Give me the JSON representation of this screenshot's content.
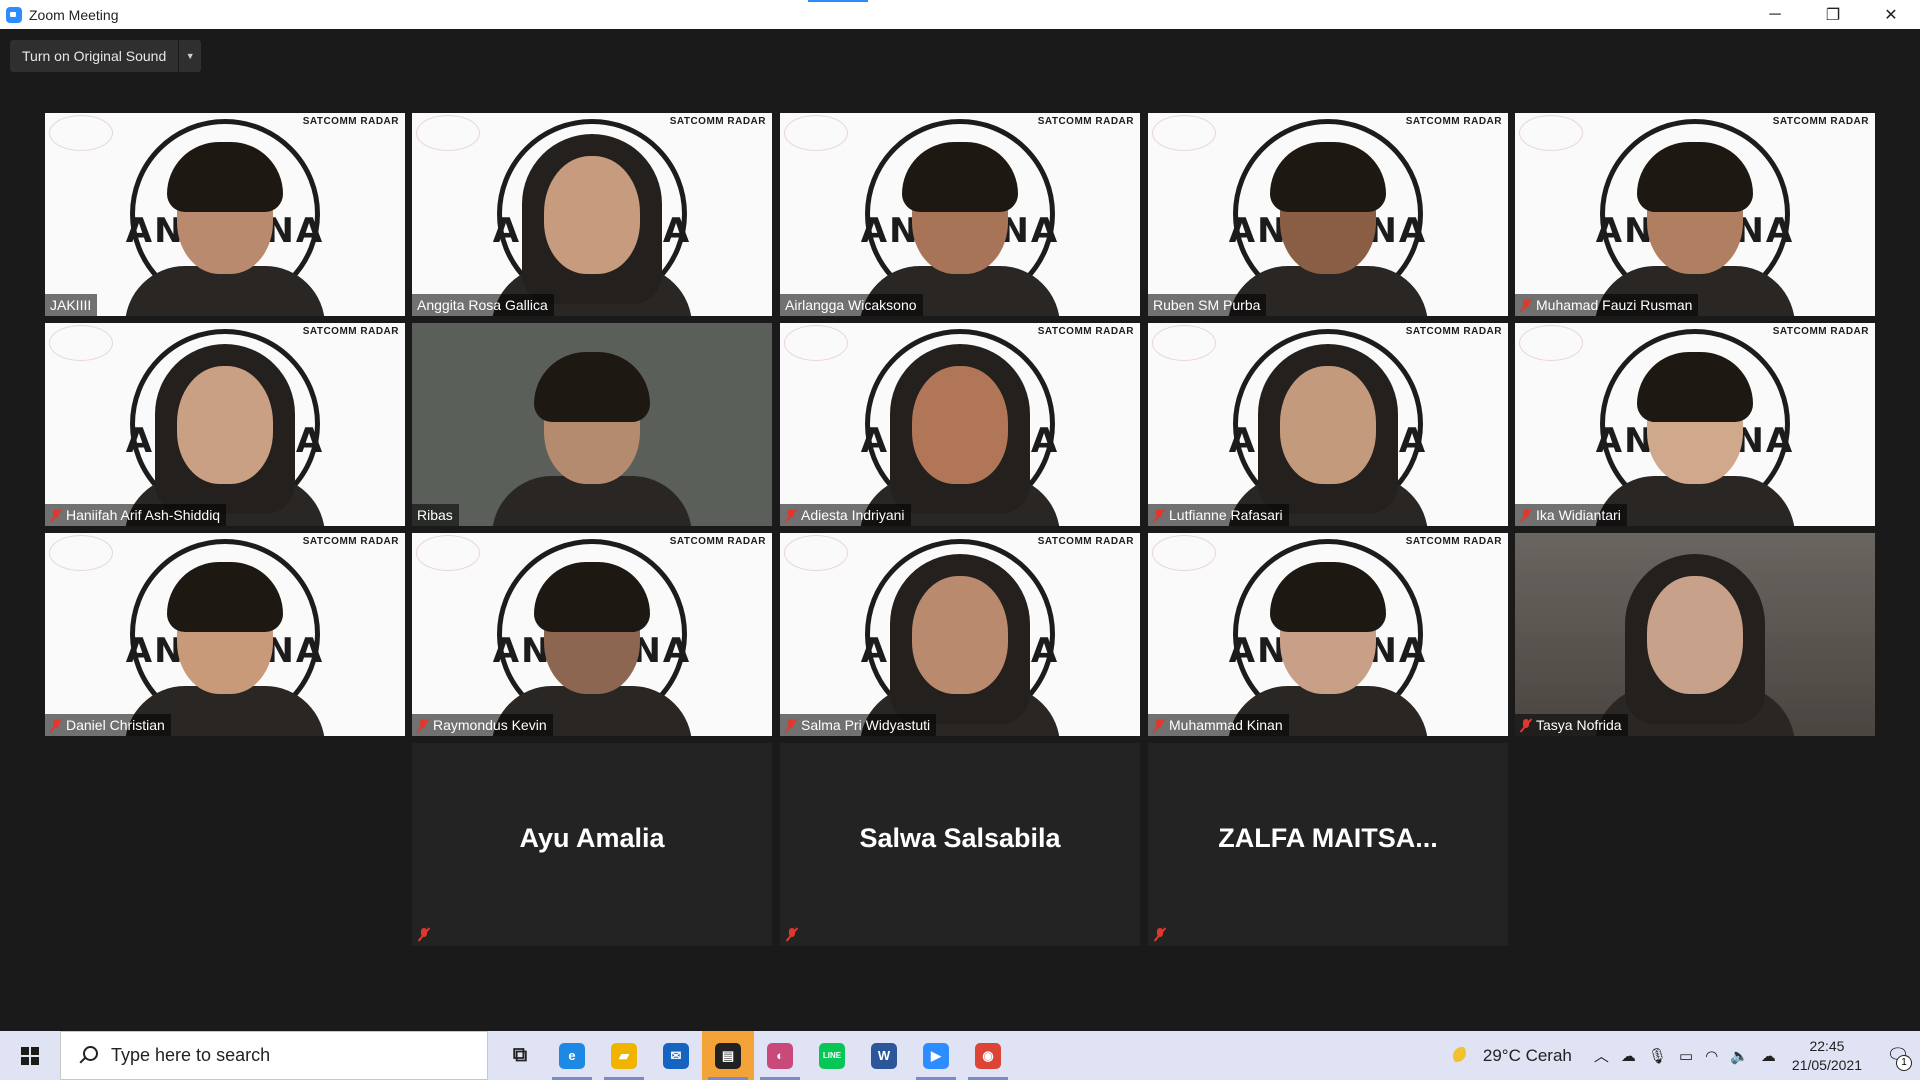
{
  "window": {
    "title": "Zoom Meeting",
    "minimize": "─",
    "restore": "❐",
    "close": "✕"
  },
  "toolbar": {
    "original_sound": "Turn on Original Sound",
    "dropdown": "▼"
  },
  "participants": [
    {
      "name": "JAKIIII",
      "muted": false,
      "bg": "antenna"
    },
    {
      "name": "Anggita Rosa Gallica",
      "muted": false,
      "bg": "antenna",
      "active": true
    },
    {
      "name": "Airlangga Wicaksono",
      "muted": false,
      "bg": "antenna"
    },
    {
      "name": "Ruben SM Purba",
      "muted": false,
      "bg": "antenna"
    },
    {
      "name": "Muhamad Fauzi Rusman",
      "muted": true,
      "bg": "antenna"
    },
    {
      "name": "Haniifah Arif Ash-Shiddiq",
      "muted": true,
      "bg": "antenna"
    },
    {
      "name": "Ribas",
      "muted": false,
      "bg": "dark"
    },
    {
      "name": "Adiesta Indriyani",
      "muted": true,
      "bg": "antenna"
    },
    {
      "name": "Lutfianne Rafasari",
      "muted": true,
      "bg": "antenna"
    },
    {
      "name": "Ika Widiantari",
      "muted": true,
      "bg": "antenna"
    },
    {
      "name": "Daniel Christian",
      "muted": true,
      "bg": "antenna"
    },
    {
      "name": "Raymondus Kevin",
      "muted": true,
      "bg": "antenna"
    },
    {
      "name": "Salma Pri Widyastuti",
      "muted": true,
      "bg": "antenna"
    },
    {
      "name": "Muhammad Kinan",
      "muted": true,
      "bg": "antenna"
    },
    {
      "name": "Tasya Nofrida",
      "muted": true,
      "bg": "room"
    }
  ],
  "no_video": [
    {
      "name": "Ayu Amalia"
    },
    {
      "name": "Salwa Salsabila"
    },
    {
      "name": "ZALFA  MAITSA..."
    }
  ],
  "background_text": {
    "logo": "ANTENNA",
    "lab": "SATCOMM RADAR"
  },
  "taskbar": {
    "search_placeholder": "Type here to search",
    "weather_temp": "29°C",
    "weather_desc": "Cerah",
    "time": "22:45",
    "date": "21/05/2021",
    "notification_count": "1",
    "apps": [
      {
        "name": "task-view-icon",
        "glyph": "⧉",
        "color": "#222222"
      },
      {
        "name": "edge-icon",
        "glyph": "e",
        "color": "#1e88e5"
      },
      {
        "name": "file-explorer-icon",
        "glyph": "▰",
        "color": "#f0b400"
      },
      {
        "name": "mail-icon",
        "glyph": "✉",
        "color": "#1565c0"
      },
      {
        "name": "sticky-notes-icon",
        "glyph": "▤",
        "color": "#222222"
      },
      {
        "name": "photos-icon",
        "glyph": "◐",
        "color": "#c94a7a"
      },
      {
        "name": "line-icon",
        "glyph": "LINE",
        "color": "#06c755"
      },
      {
        "name": "word-icon",
        "glyph": "W",
        "color": "#2b579a"
      },
      {
        "name": "zoom-icon",
        "glyph": "▶",
        "color": "#2d8cff"
      },
      {
        "name": "chrome-icon",
        "glyph": "◉",
        "color": "#db4437"
      }
    ]
  },
  "colors": {
    "active_speaker": "#d9ff3a",
    "muted": "#e0382f",
    "meeting_bg": "#1a1a1a",
    "taskbar_bg": "#dfe3f3"
  }
}
